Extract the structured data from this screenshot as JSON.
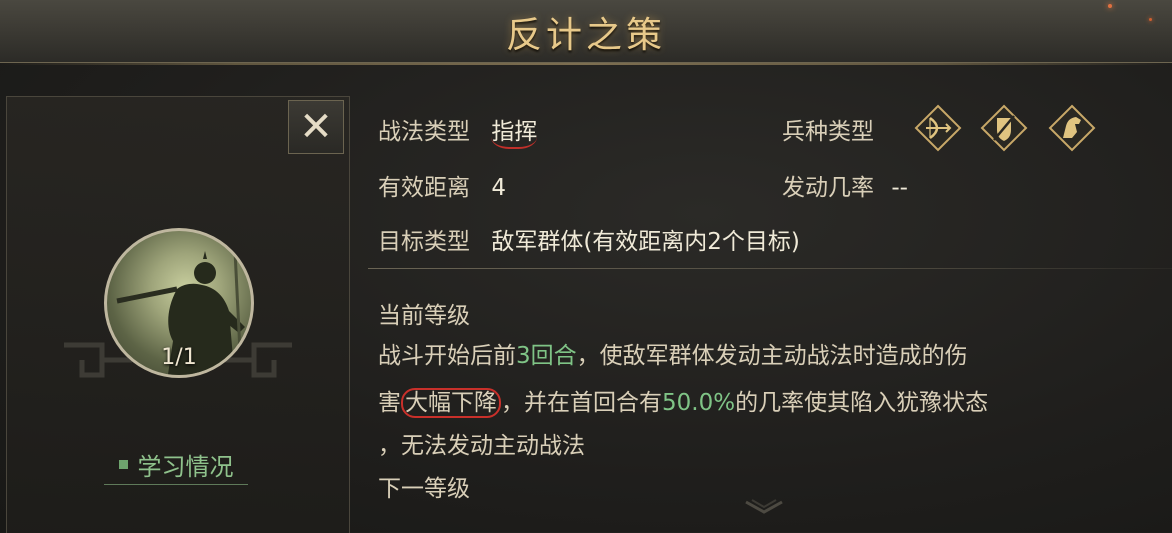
{
  "title": "反计之策",
  "close_icon": "close-icon",
  "skill": {
    "level": "1/1",
    "learn_status": "学习情况"
  },
  "info": {
    "tactic_type_label": "战法类型",
    "tactic_type_value": "指挥",
    "troop_type_label": "兵种类型",
    "troop_icons": [
      "archer-icon",
      "shield-infantry-icon",
      "cavalry-icon"
    ],
    "range_label": "有效距离",
    "range_value": "4",
    "trigger_rate_label": "发动几率",
    "trigger_rate_value": "--",
    "target_type_label": "目标类型",
    "target_type_value": "敌军群体(有效距离内2个目标)"
  },
  "description": {
    "current_level_label": "当前等级",
    "line1_a": "战斗开始后前",
    "line1_hl": "3回合",
    "line1_b": "，使敌军群体发动主动战法时造成的伤",
    "line2_a": "害",
    "line2_circled": "大幅下降",
    "line2_b": "，并在首回合有",
    "line2_hl": "50.0%",
    "line2_c": "的几率使其陷入犹豫状态",
    "line3": "，无法发动主动战法",
    "next_level_label": "下一等级"
  },
  "colors": {
    "title": "#e8c98a",
    "highlight": "#7fc486",
    "annotation": "#c9302a",
    "learn": "#8fc28c"
  }
}
